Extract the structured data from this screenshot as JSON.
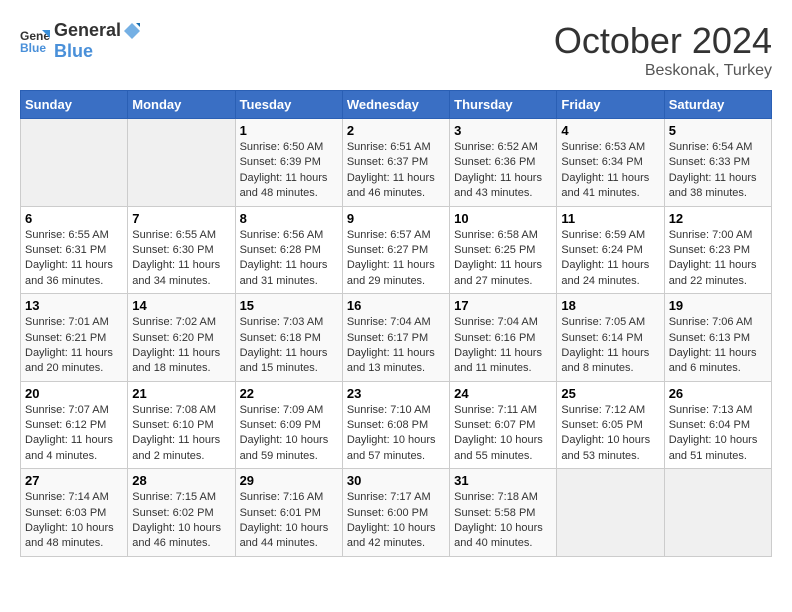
{
  "header": {
    "logo_general": "General",
    "logo_blue": "Blue",
    "month": "October 2024",
    "location": "Beskonak, Turkey"
  },
  "weekdays": [
    "Sunday",
    "Monday",
    "Tuesday",
    "Wednesday",
    "Thursday",
    "Friday",
    "Saturday"
  ],
  "weeks": [
    [
      {
        "day": "",
        "info": ""
      },
      {
        "day": "",
        "info": ""
      },
      {
        "day": "1",
        "info": "Sunrise: 6:50 AM\nSunset: 6:39 PM\nDaylight: 11 hours and 48 minutes."
      },
      {
        "day": "2",
        "info": "Sunrise: 6:51 AM\nSunset: 6:37 PM\nDaylight: 11 hours and 46 minutes."
      },
      {
        "day": "3",
        "info": "Sunrise: 6:52 AM\nSunset: 6:36 PM\nDaylight: 11 hours and 43 minutes."
      },
      {
        "day": "4",
        "info": "Sunrise: 6:53 AM\nSunset: 6:34 PM\nDaylight: 11 hours and 41 minutes."
      },
      {
        "day": "5",
        "info": "Sunrise: 6:54 AM\nSunset: 6:33 PM\nDaylight: 11 hours and 38 minutes."
      }
    ],
    [
      {
        "day": "6",
        "info": "Sunrise: 6:55 AM\nSunset: 6:31 PM\nDaylight: 11 hours and 36 minutes."
      },
      {
        "day": "7",
        "info": "Sunrise: 6:55 AM\nSunset: 6:30 PM\nDaylight: 11 hours and 34 minutes."
      },
      {
        "day": "8",
        "info": "Sunrise: 6:56 AM\nSunset: 6:28 PM\nDaylight: 11 hours and 31 minutes."
      },
      {
        "day": "9",
        "info": "Sunrise: 6:57 AM\nSunset: 6:27 PM\nDaylight: 11 hours and 29 minutes."
      },
      {
        "day": "10",
        "info": "Sunrise: 6:58 AM\nSunset: 6:25 PM\nDaylight: 11 hours and 27 minutes."
      },
      {
        "day": "11",
        "info": "Sunrise: 6:59 AM\nSunset: 6:24 PM\nDaylight: 11 hours and 24 minutes."
      },
      {
        "day": "12",
        "info": "Sunrise: 7:00 AM\nSunset: 6:23 PM\nDaylight: 11 hours and 22 minutes."
      }
    ],
    [
      {
        "day": "13",
        "info": "Sunrise: 7:01 AM\nSunset: 6:21 PM\nDaylight: 11 hours and 20 minutes."
      },
      {
        "day": "14",
        "info": "Sunrise: 7:02 AM\nSunset: 6:20 PM\nDaylight: 11 hours and 18 minutes."
      },
      {
        "day": "15",
        "info": "Sunrise: 7:03 AM\nSunset: 6:18 PM\nDaylight: 11 hours and 15 minutes."
      },
      {
        "day": "16",
        "info": "Sunrise: 7:04 AM\nSunset: 6:17 PM\nDaylight: 11 hours and 13 minutes."
      },
      {
        "day": "17",
        "info": "Sunrise: 7:04 AM\nSunset: 6:16 PM\nDaylight: 11 hours and 11 minutes."
      },
      {
        "day": "18",
        "info": "Sunrise: 7:05 AM\nSunset: 6:14 PM\nDaylight: 11 hours and 8 minutes."
      },
      {
        "day": "19",
        "info": "Sunrise: 7:06 AM\nSunset: 6:13 PM\nDaylight: 11 hours and 6 minutes."
      }
    ],
    [
      {
        "day": "20",
        "info": "Sunrise: 7:07 AM\nSunset: 6:12 PM\nDaylight: 11 hours and 4 minutes."
      },
      {
        "day": "21",
        "info": "Sunrise: 7:08 AM\nSunset: 6:10 PM\nDaylight: 11 hours and 2 minutes."
      },
      {
        "day": "22",
        "info": "Sunrise: 7:09 AM\nSunset: 6:09 PM\nDaylight: 10 hours and 59 minutes."
      },
      {
        "day": "23",
        "info": "Sunrise: 7:10 AM\nSunset: 6:08 PM\nDaylight: 10 hours and 57 minutes."
      },
      {
        "day": "24",
        "info": "Sunrise: 7:11 AM\nSunset: 6:07 PM\nDaylight: 10 hours and 55 minutes."
      },
      {
        "day": "25",
        "info": "Sunrise: 7:12 AM\nSunset: 6:05 PM\nDaylight: 10 hours and 53 minutes."
      },
      {
        "day": "26",
        "info": "Sunrise: 7:13 AM\nSunset: 6:04 PM\nDaylight: 10 hours and 51 minutes."
      }
    ],
    [
      {
        "day": "27",
        "info": "Sunrise: 7:14 AM\nSunset: 6:03 PM\nDaylight: 10 hours and 48 minutes."
      },
      {
        "day": "28",
        "info": "Sunrise: 7:15 AM\nSunset: 6:02 PM\nDaylight: 10 hours and 46 minutes."
      },
      {
        "day": "29",
        "info": "Sunrise: 7:16 AM\nSunset: 6:01 PM\nDaylight: 10 hours and 44 minutes."
      },
      {
        "day": "30",
        "info": "Sunrise: 7:17 AM\nSunset: 6:00 PM\nDaylight: 10 hours and 42 minutes."
      },
      {
        "day": "31",
        "info": "Sunrise: 7:18 AM\nSunset: 5:58 PM\nDaylight: 10 hours and 40 minutes."
      },
      {
        "day": "",
        "info": ""
      },
      {
        "day": "",
        "info": ""
      }
    ]
  ]
}
